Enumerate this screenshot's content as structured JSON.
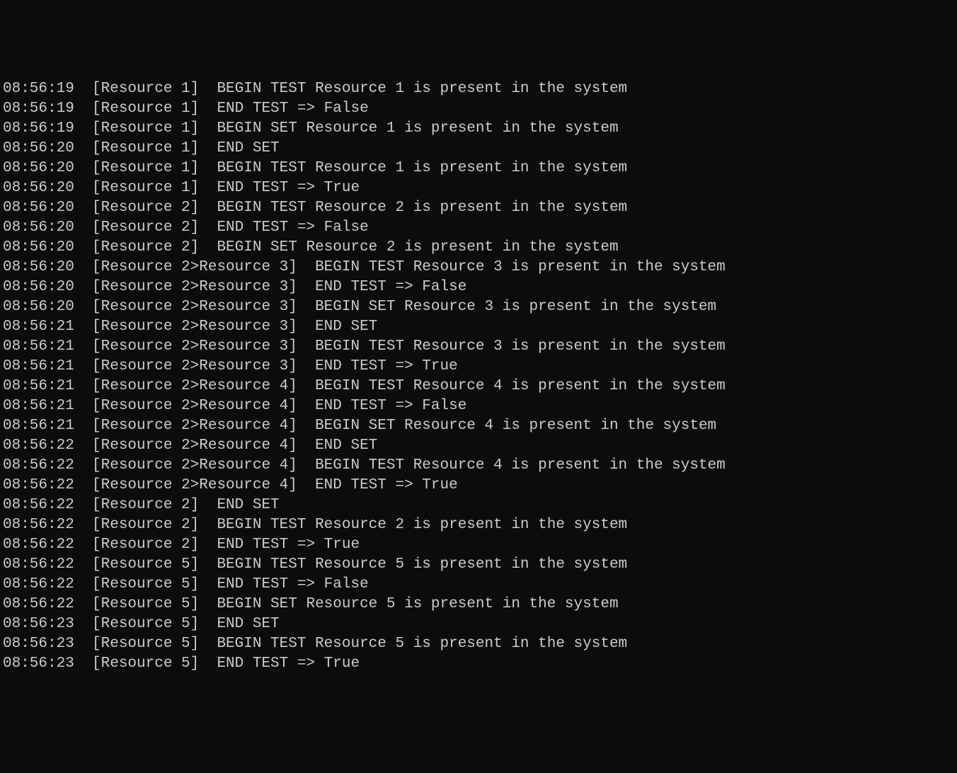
{
  "log_lines": [
    "08:56:19  [Resource 1]  BEGIN TEST Resource 1 is present in the system",
    "08:56:19  [Resource 1]  END TEST => False",
    "08:56:19  [Resource 1]  BEGIN SET Resource 1 is present in the system",
    "08:56:20  [Resource 1]  END SET",
    "08:56:20  [Resource 1]  BEGIN TEST Resource 1 is present in the system",
    "08:56:20  [Resource 1]  END TEST => True",
    "08:56:20  [Resource 2]  BEGIN TEST Resource 2 is present in the system",
    "08:56:20  [Resource 2]  END TEST => False",
    "08:56:20  [Resource 2]  BEGIN SET Resource 2 is present in the system",
    "08:56:20  [Resource 2>Resource 3]  BEGIN TEST Resource 3 is present in the system",
    "08:56:20  [Resource 2>Resource 3]  END TEST => False",
    "08:56:20  [Resource 2>Resource 3]  BEGIN SET Resource 3 is present in the system",
    "08:56:21  [Resource 2>Resource 3]  END SET",
    "08:56:21  [Resource 2>Resource 3]  BEGIN TEST Resource 3 is present in the system",
    "08:56:21  [Resource 2>Resource 3]  END TEST => True",
    "08:56:21  [Resource 2>Resource 4]  BEGIN TEST Resource 4 is present in the system",
    "08:56:21  [Resource 2>Resource 4]  END TEST => False",
    "08:56:21  [Resource 2>Resource 4]  BEGIN SET Resource 4 is present in the system",
    "08:56:22  [Resource 2>Resource 4]  END SET",
    "08:56:22  [Resource 2>Resource 4]  BEGIN TEST Resource 4 is present in the system",
    "08:56:22  [Resource 2>Resource 4]  END TEST => True",
    "08:56:22  [Resource 2]  END SET",
    "08:56:22  [Resource 2]  BEGIN TEST Resource 2 is present in the system",
    "08:56:22  [Resource 2]  END TEST => True",
    "08:56:22  [Resource 5]  BEGIN TEST Resource 5 is present in the system",
    "08:56:22  [Resource 5]  END TEST => False",
    "08:56:22  [Resource 5]  BEGIN SET Resource 5 is present in the system",
    "08:56:23  [Resource 5]  END SET",
    "08:56:23  [Resource 5]  BEGIN TEST Resource 5 is present in the system",
    "08:56:23  [Resource 5]  END TEST => True"
  ]
}
